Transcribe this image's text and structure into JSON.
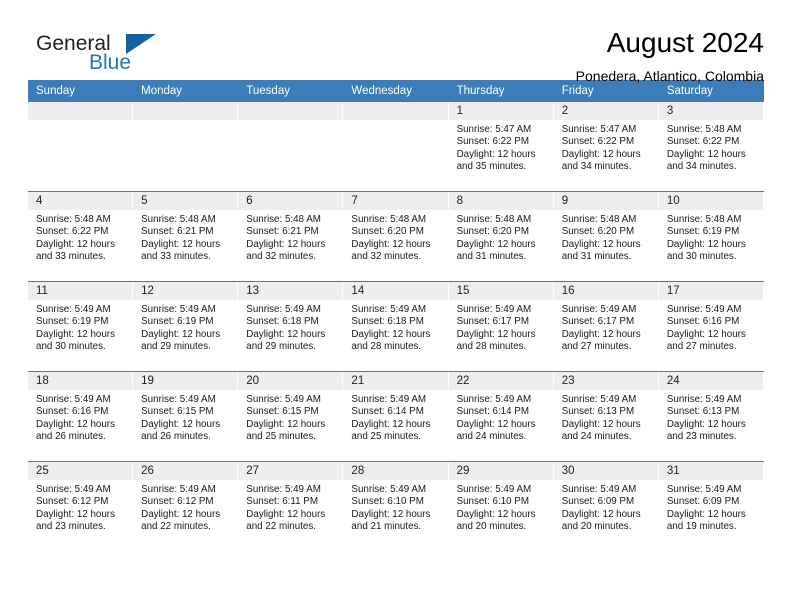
{
  "brand": {
    "word1": "General",
    "word2": "Blue",
    "accent_color": "#1b78c2",
    "triangle_color": "#15619e"
  },
  "header": {
    "title": "August 2024",
    "subtitle": "Ponedera, Atlantico, Colombia"
  },
  "theme": {
    "header_bg": "#3c7cb8",
    "daynum_bg": "#eeeeee",
    "grid_line": "#3c7cb8"
  },
  "labels": {
    "sunrise_prefix": "Sunrise:",
    "sunset_prefix": "Sunset:",
    "daylight_prefix": "Daylight:"
  },
  "weekdays": [
    "Sunday",
    "Monday",
    "Tuesday",
    "Wednesday",
    "Thursday",
    "Friday",
    "Saturday"
  ],
  "weeks": [
    [
      {
        "day": ""
      },
      {
        "day": ""
      },
      {
        "day": ""
      },
      {
        "day": ""
      },
      {
        "day": "1",
        "sunrise": "Sunrise: 5:47 AM",
        "sunset": "Sunset: 6:22 PM",
        "daylight": "Daylight: 12 hours and 35 minutes."
      },
      {
        "day": "2",
        "sunrise": "Sunrise: 5:47 AM",
        "sunset": "Sunset: 6:22 PM",
        "daylight": "Daylight: 12 hours and 34 minutes."
      },
      {
        "day": "3",
        "sunrise": "Sunrise: 5:48 AM",
        "sunset": "Sunset: 6:22 PM",
        "daylight": "Daylight: 12 hours and 34 minutes."
      }
    ],
    [
      {
        "day": "4",
        "sunrise": "Sunrise: 5:48 AM",
        "sunset": "Sunset: 6:22 PM",
        "daylight": "Daylight: 12 hours and 33 minutes."
      },
      {
        "day": "5",
        "sunrise": "Sunrise: 5:48 AM",
        "sunset": "Sunset: 6:21 PM",
        "daylight": "Daylight: 12 hours and 33 minutes."
      },
      {
        "day": "6",
        "sunrise": "Sunrise: 5:48 AM",
        "sunset": "Sunset: 6:21 PM",
        "daylight": "Daylight: 12 hours and 32 minutes."
      },
      {
        "day": "7",
        "sunrise": "Sunrise: 5:48 AM",
        "sunset": "Sunset: 6:20 PM",
        "daylight": "Daylight: 12 hours and 32 minutes."
      },
      {
        "day": "8",
        "sunrise": "Sunrise: 5:48 AM",
        "sunset": "Sunset: 6:20 PM",
        "daylight": "Daylight: 12 hours and 31 minutes."
      },
      {
        "day": "9",
        "sunrise": "Sunrise: 5:48 AM",
        "sunset": "Sunset: 6:20 PM",
        "daylight": "Daylight: 12 hours and 31 minutes."
      },
      {
        "day": "10",
        "sunrise": "Sunrise: 5:48 AM",
        "sunset": "Sunset: 6:19 PM",
        "daylight": "Daylight: 12 hours and 30 minutes."
      }
    ],
    [
      {
        "day": "11",
        "sunrise": "Sunrise: 5:49 AM",
        "sunset": "Sunset: 6:19 PM",
        "daylight": "Daylight: 12 hours and 30 minutes."
      },
      {
        "day": "12",
        "sunrise": "Sunrise: 5:49 AM",
        "sunset": "Sunset: 6:19 PM",
        "daylight": "Daylight: 12 hours and 29 minutes."
      },
      {
        "day": "13",
        "sunrise": "Sunrise: 5:49 AM",
        "sunset": "Sunset: 6:18 PM",
        "daylight": "Daylight: 12 hours and 29 minutes."
      },
      {
        "day": "14",
        "sunrise": "Sunrise: 5:49 AM",
        "sunset": "Sunset: 6:18 PM",
        "daylight": "Daylight: 12 hours and 28 minutes."
      },
      {
        "day": "15",
        "sunrise": "Sunrise: 5:49 AM",
        "sunset": "Sunset: 6:17 PM",
        "daylight": "Daylight: 12 hours and 28 minutes."
      },
      {
        "day": "16",
        "sunrise": "Sunrise: 5:49 AM",
        "sunset": "Sunset: 6:17 PM",
        "daylight": "Daylight: 12 hours and 27 minutes."
      },
      {
        "day": "17",
        "sunrise": "Sunrise: 5:49 AM",
        "sunset": "Sunset: 6:16 PM",
        "daylight": "Daylight: 12 hours and 27 minutes."
      }
    ],
    [
      {
        "day": "18",
        "sunrise": "Sunrise: 5:49 AM",
        "sunset": "Sunset: 6:16 PM",
        "daylight": "Daylight: 12 hours and 26 minutes."
      },
      {
        "day": "19",
        "sunrise": "Sunrise: 5:49 AM",
        "sunset": "Sunset: 6:15 PM",
        "daylight": "Daylight: 12 hours and 26 minutes."
      },
      {
        "day": "20",
        "sunrise": "Sunrise: 5:49 AM",
        "sunset": "Sunset: 6:15 PM",
        "daylight": "Daylight: 12 hours and 25 minutes."
      },
      {
        "day": "21",
        "sunrise": "Sunrise: 5:49 AM",
        "sunset": "Sunset: 6:14 PM",
        "daylight": "Daylight: 12 hours and 25 minutes."
      },
      {
        "day": "22",
        "sunrise": "Sunrise: 5:49 AM",
        "sunset": "Sunset: 6:14 PM",
        "daylight": "Daylight: 12 hours and 24 minutes."
      },
      {
        "day": "23",
        "sunrise": "Sunrise: 5:49 AM",
        "sunset": "Sunset: 6:13 PM",
        "daylight": "Daylight: 12 hours and 24 minutes."
      },
      {
        "day": "24",
        "sunrise": "Sunrise: 5:49 AM",
        "sunset": "Sunset: 6:13 PM",
        "daylight": "Daylight: 12 hours and 23 minutes."
      }
    ],
    [
      {
        "day": "25",
        "sunrise": "Sunrise: 5:49 AM",
        "sunset": "Sunset: 6:12 PM",
        "daylight": "Daylight: 12 hours and 23 minutes."
      },
      {
        "day": "26",
        "sunrise": "Sunrise: 5:49 AM",
        "sunset": "Sunset: 6:12 PM",
        "daylight": "Daylight: 12 hours and 22 minutes."
      },
      {
        "day": "27",
        "sunrise": "Sunrise: 5:49 AM",
        "sunset": "Sunset: 6:11 PM",
        "daylight": "Daylight: 12 hours and 22 minutes."
      },
      {
        "day": "28",
        "sunrise": "Sunrise: 5:49 AM",
        "sunset": "Sunset: 6:10 PM",
        "daylight": "Daylight: 12 hours and 21 minutes."
      },
      {
        "day": "29",
        "sunrise": "Sunrise: 5:49 AM",
        "sunset": "Sunset: 6:10 PM",
        "daylight": "Daylight: 12 hours and 20 minutes."
      },
      {
        "day": "30",
        "sunrise": "Sunrise: 5:49 AM",
        "sunset": "Sunset: 6:09 PM",
        "daylight": "Daylight: 12 hours and 20 minutes."
      },
      {
        "day": "31",
        "sunrise": "Sunrise: 5:49 AM",
        "sunset": "Sunset: 6:09 PM",
        "daylight": "Daylight: 12 hours and 19 minutes."
      }
    ]
  ]
}
